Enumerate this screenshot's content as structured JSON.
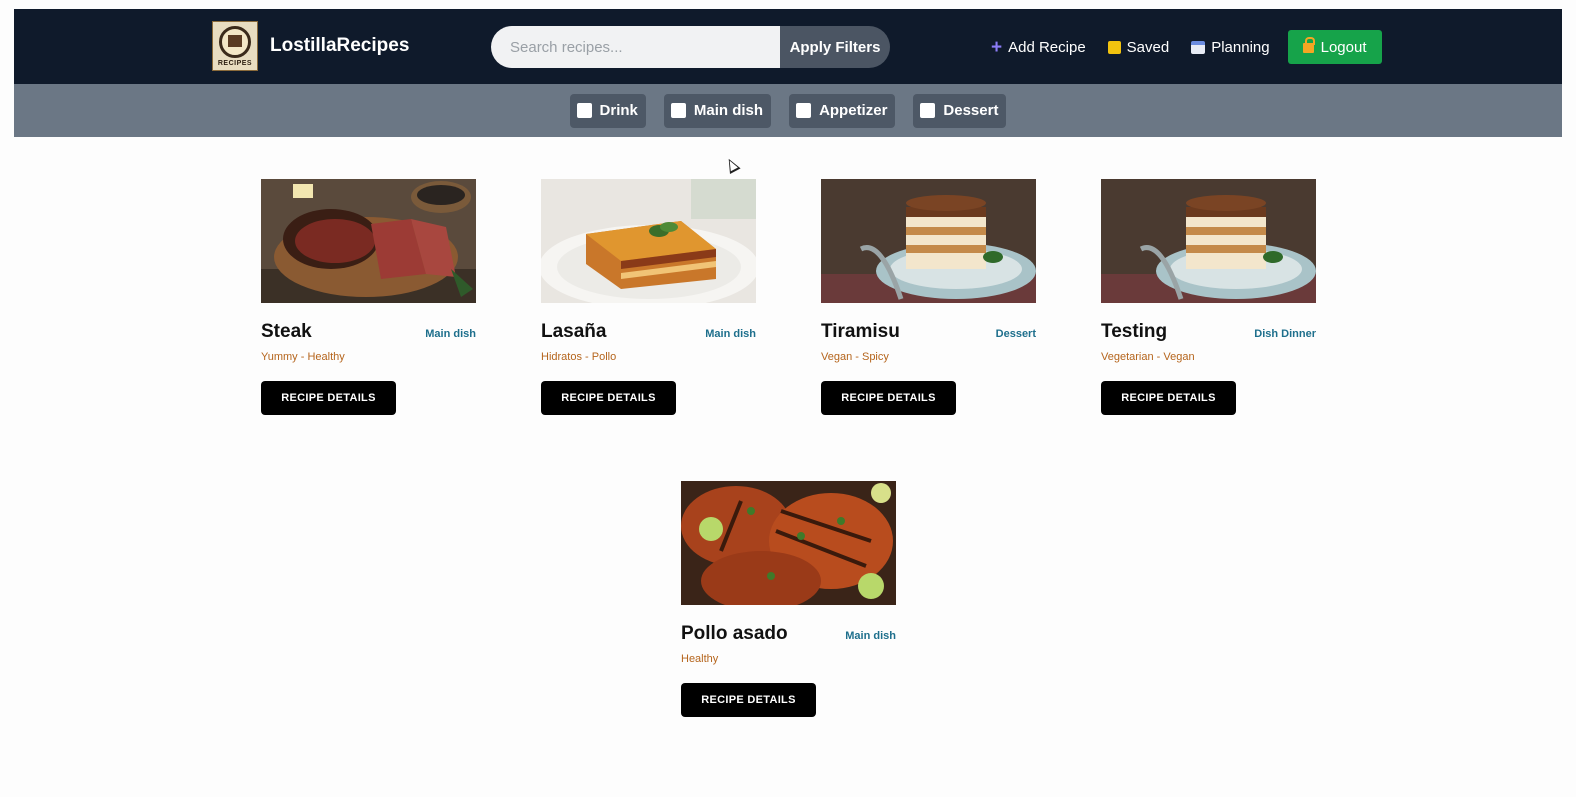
{
  "brand": {
    "name": "LostillaRecipes",
    "logo_text": "RECIPES"
  },
  "search": {
    "placeholder": "Search recipes...",
    "value": "",
    "apply_label": "Apply Filters"
  },
  "nav": {
    "add_recipe": "Add Recipe",
    "saved": "Saved",
    "planning": "Planning",
    "logout": "Logout"
  },
  "filters": [
    {
      "label": "Drink",
      "checked": false
    },
    {
      "label": "Main dish",
      "checked": false
    },
    {
      "label": "Appetizer",
      "checked": false
    },
    {
      "label": "Dessert",
      "checked": false
    }
  ],
  "recipes": [
    {
      "title": "Steak",
      "category": "Main dish",
      "tags": "Yummy - Healthy",
      "button": "RECIPE DETAILS",
      "image": "steak"
    },
    {
      "title": "Lasaña",
      "category": "Main dish",
      "tags": "Hidratos - Pollo",
      "button": "RECIPE DETAILS",
      "image": "lasagna"
    },
    {
      "title": "Tiramisu",
      "category": "Dessert",
      "tags": "Vegan - Spicy",
      "button": "RECIPE DETAILS",
      "image": "tiramisu"
    },
    {
      "title": "Testing",
      "category": "Dish Dinner",
      "tags": "Vegetarian - Vegan",
      "button": "RECIPE DETAILS",
      "image": "tiramisu"
    },
    {
      "title": "Pollo asado",
      "category": "Main dish",
      "tags": "Healthy",
      "button": "RECIPE DETAILS",
      "image": "chicken"
    }
  ],
  "colors": {
    "navbar": "#0f1a2b",
    "filterbar": "#6b7785",
    "logout": "#16a34a",
    "category": "#1e6f8c",
    "tags": "#b5651d"
  }
}
